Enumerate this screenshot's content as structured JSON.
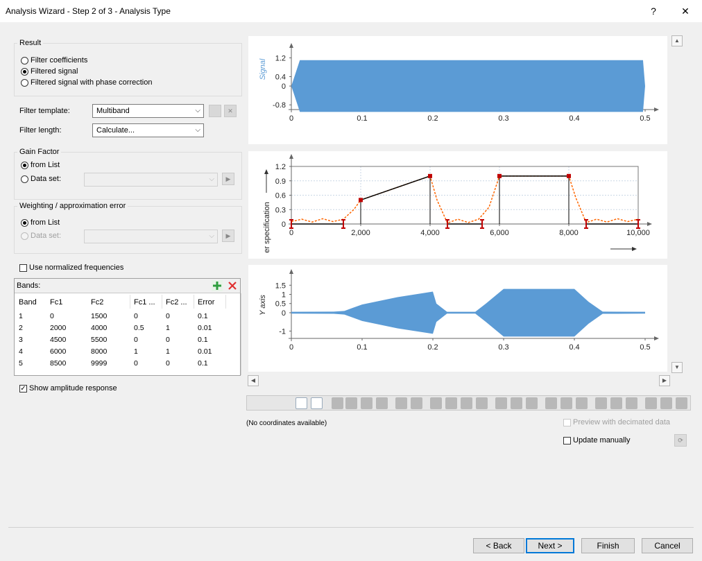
{
  "window": {
    "title": "Analysis Wizard - Step 2 of 3 - Analysis Type",
    "help": "?",
    "close": "✕"
  },
  "result": {
    "group_label": "Result",
    "options": [
      "Filter coefficients",
      "Filtered signal",
      "Filtered signal with phase correction"
    ],
    "selected": "Filtered signal"
  },
  "filter_template": {
    "label": "Filter template:",
    "value": "Multiband"
  },
  "filter_length": {
    "label": "Filter length:",
    "value": "Calculate..."
  },
  "gain_factor": {
    "group_label": "Gain Factor",
    "from_list": "from List",
    "data_set": "Data set:",
    "selected": "from List"
  },
  "weighting": {
    "group_label": "Weighting / approximation error",
    "from_list": "from List",
    "data_set": "Data set:",
    "selected": "from List"
  },
  "normalized": {
    "label": "Use normalized frequencies",
    "checked": false
  },
  "bands": {
    "title": "Bands:",
    "columns": [
      "Band",
      "Fc1",
      "Fc2",
      "Fc1 ...",
      "Fc2 ...",
      "Error"
    ],
    "rows": [
      [
        "1",
        "0",
        "1500",
        "0",
        "0",
        "0.1"
      ],
      [
        "2",
        "2000",
        "4000",
        "0.5",
        "1",
        "0.01"
      ],
      [
        "3",
        "4500",
        "5500",
        "0",
        "0",
        "0.1"
      ],
      [
        "4",
        "6000",
        "8000",
        "1",
        "1",
        "0.01"
      ],
      [
        "5",
        "8500",
        "9999",
        "0",
        "0",
        "0.1"
      ]
    ]
  },
  "show_amplitude": {
    "label": "Show amplitude response",
    "checked": true
  },
  "status_text": "(No coordinates available)",
  "preview_decimated": {
    "label": "Preview with decimated data",
    "checked": false,
    "enabled": false
  },
  "update_manually": {
    "label": "Update manually",
    "checked": false
  },
  "buttons": {
    "back": "< Back",
    "next": "Next >",
    "finish": "Finish",
    "cancel": "Cancel"
  },
  "colors": {
    "signal": "#5b9bd5",
    "spec": "#c00000",
    "approx": "#ff6600",
    "accent": "#0078d7"
  },
  "chart_data": [
    {
      "type": "area",
      "ylabel": "Signal",
      "xlim": [
        0,
        0.5
      ],
      "ylim": [
        -1.0,
        1.3
      ],
      "x_ticks": [
        "0",
        "0.1",
        "0.2",
        "0.3",
        "0.4",
        "0.5"
      ],
      "y_ticks": [
        "1.2",
        "0.4",
        "0",
        "-0.8"
      ],
      "envelope": {
        "x": [
          0,
          0.012,
          0.497,
          0.5
        ],
        "upper": [
          0,
          1.1,
          1.1,
          0
        ],
        "lower": [
          0,
          -1.1,
          -1.1,
          0
        ]
      }
    },
    {
      "type": "line",
      "ylabel": "er specification",
      "xlim": [
        0,
        10000
      ],
      "ylim": [
        0,
        1.2
      ],
      "x_ticks": [
        "0",
        "2,000",
        "4,000",
        "6,000",
        "8,000",
        "10,000"
      ],
      "y_ticks": [
        "1.2",
        "0.9",
        "0.6",
        "0.3",
        "0"
      ],
      "specification": [
        {
          "x": [
            0,
            1500
          ],
          "y": [
            0,
            0
          ]
        },
        {
          "x": [
            2000,
            4000
          ],
          "y": [
            0.5,
            1
          ]
        },
        {
          "x": [
            4500,
            5500
          ],
          "y": [
            0,
            0
          ]
        },
        {
          "x": [
            6000,
            8000
          ],
          "y": [
            1,
            1
          ]
        },
        {
          "x": [
            8500,
            10000
          ],
          "y": [
            0,
            0
          ]
        }
      ],
      "approximation": {
        "x": [
          0,
          300,
          600,
          900,
          1200,
          1500,
          1800,
          2000,
          3000,
          4000,
          4200,
          4500,
          4800,
          5100,
          5400,
          5700,
          6000,
          7000,
          8000,
          8200,
          8500,
          8800,
          9100,
          9400,
          9700,
          10000
        ],
        "y": [
          0.05,
          0.1,
          0.04,
          0.11,
          0.05,
          0.1,
          0.3,
          0.5,
          0.75,
          1.0,
          0.5,
          0.02,
          0.1,
          0.03,
          0.1,
          0.35,
          1.0,
          1.0,
          1.0,
          0.55,
          0.03,
          0.1,
          0.04,
          0.11,
          0.05,
          0.1
        ]
      }
    },
    {
      "type": "area",
      "ylabel": "Y axis",
      "xlim": [
        0,
        0.5
      ],
      "ylim": [
        -1.4,
        1.7
      ],
      "x_ticks": [
        "0",
        "0.1",
        "0.2",
        "0.3",
        "0.4",
        "0.5"
      ],
      "y_ticks": [
        "1.5",
        "1",
        "0.5",
        "0",
        "-1"
      ],
      "envelope": {
        "x": [
          0,
          0.06,
          0.075,
          0.1,
          0.15,
          0.2,
          0.205,
          0.22,
          0.26,
          0.275,
          0.3,
          0.4,
          0.42,
          0.44,
          0.5
        ],
        "upper": [
          0.05,
          0.06,
          0.1,
          0.45,
          0.85,
          1.15,
          0.5,
          0.05,
          0.05,
          0.5,
          1.3,
          1.3,
          0.6,
          0.06,
          0.05
        ],
        "lower": [
          -0.05,
          -0.06,
          -0.1,
          -0.45,
          -0.85,
          -1.15,
          -0.5,
          -0.05,
          -0.05,
          -0.5,
          -1.3,
          -1.3,
          -0.6,
          -0.06,
          -0.05
        ]
      }
    }
  ]
}
